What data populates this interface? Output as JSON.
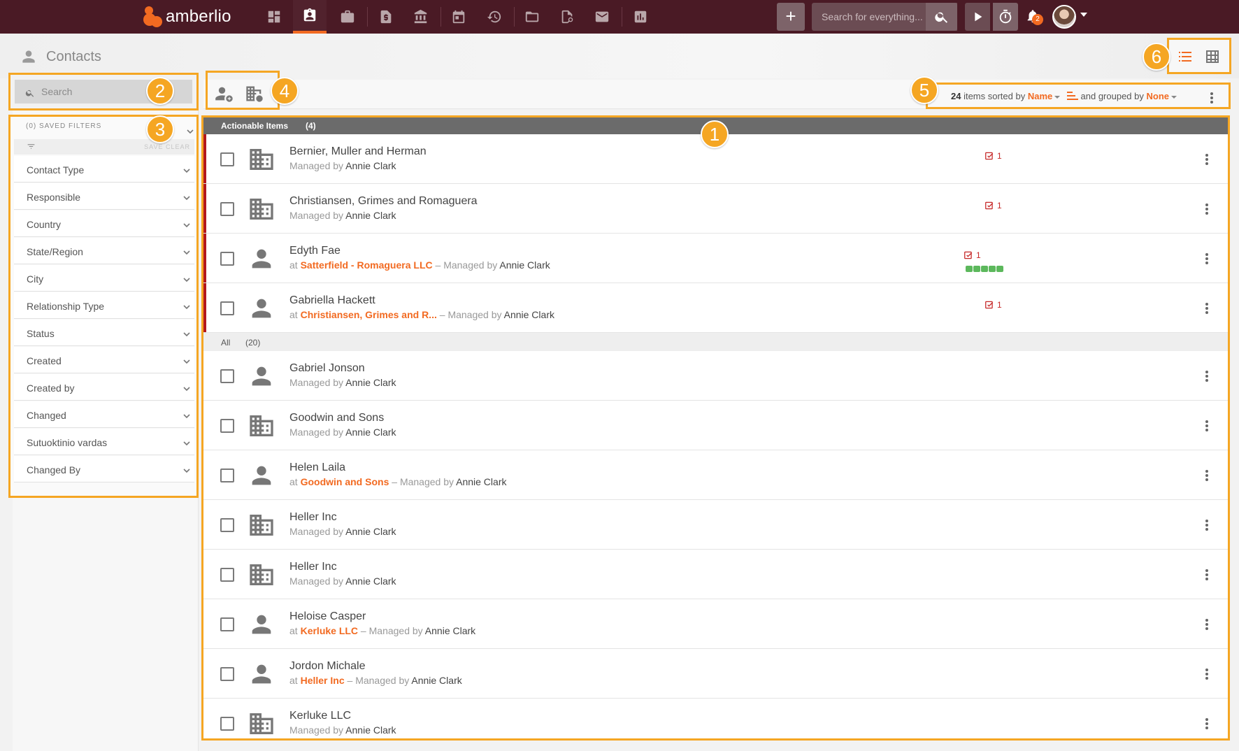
{
  "app": {
    "brand": "amberlio",
    "top_search_placeholder": "Search for everything...",
    "notification_count": "2",
    "accent": "#f26a21",
    "topbar_color": "#4a1a25",
    "nav_icons": [
      "dashboard-icon",
      "contacts-icon",
      "projects-icon",
      "invoices-icon",
      "bank-icon",
      "calendar-icon",
      "history-icon",
      "folder-icon",
      "documents-icon",
      "mail-icon",
      "reports-icon"
    ]
  },
  "page": {
    "title": "Contacts"
  },
  "sidebar": {
    "search_placeholder": "Search",
    "saved_filters": "(0) SAVED FILTERS",
    "save_clear": "SAVE  CLEAR",
    "filters": [
      {
        "label": "Contact Type"
      },
      {
        "label": "Responsible"
      },
      {
        "label": "Country"
      },
      {
        "label": "State/Region"
      },
      {
        "label": "City"
      },
      {
        "label": "Relationship Type"
      },
      {
        "label": "Status"
      },
      {
        "label": "Created"
      },
      {
        "label": "Created by"
      },
      {
        "label": "Changed"
      },
      {
        "label": "Sutuoktinio vardas"
      },
      {
        "label": "Changed By"
      }
    ]
  },
  "toolbar": {
    "count": "24",
    "sorted_by_text": " items sorted by ",
    "sort_field": "Name",
    "grouped_by_text": " and grouped by ",
    "group_field": "None"
  },
  "groups": {
    "actionable": {
      "label": "Actionable Items",
      "count": "(4)"
    },
    "all": {
      "label": "All",
      "count": "(20)"
    }
  },
  "rows": [
    {
      "name": "Bernier, Muller and Herman",
      "type": "company",
      "org": "",
      "managed_prefix": "Managed by ",
      "manager": "Annie Clark",
      "tasks": "1",
      "progress": false
    },
    {
      "name": "Christiansen, Grimes and Romaguera",
      "type": "company",
      "org": "",
      "managed_prefix": "Managed by ",
      "manager": "Annie Clark",
      "tasks": "1",
      "progress": false
    },
    {
      "name": "Edyth Fae",
      "type": "person",
      "at": "at ",
      "org": "Satterfield - Romaguera LLC",
      "sep": " –  ",
      "managed_prefix": "Managed by ",
      "manager": "Annie Clark",
      "tasks": "1",
      "progress": true
    },
    {
      "name": "Gabriella Hackett",
      "type": "person",
      "at": "at ",
      "org": "Christiansen, Grimes and R...",
      "sep": "  –  ",
      "managed_prefix": "Managed by ",
      "manager": "Annie Clark",
      "tasks": "1",
      "progress": false
    },
    {
      "name": "Gabriel Jonson",
      "type": "person",
      "org": "",
      "managed_prefix": "Managed by ",
      "manager": "Annie Clark"
    },
    {
      "name": "Goodwin and Sons",
      "type": "company",
      "org": "",
      "managed_prefix": "Managed by ",
      "manager": "Annie Clark"
    },
    {
      "name": "Helen Laila",
      "type": "person",
      "at": "at ",
      "org": "Goodwin and Sons",
      "sep": " –  ",
      "managed_prefix": "Managed by ",
      "manager": "Annie Clark"
    },
    {
      "name": "Heller Inc",
      "type": "company",
      "org": "",
      "managed_prefix": "Managed by ",
      "manager": "Annie Clark"
    },
    {
      "name": "Heller Inc",
      "type": "company",
      "org": "",
      "managed_prefix": "Managed by ",
      "manager": "Annie Clark"
    },
    {
      "name": "Heloise Casper",
      "type": "person",
      "at": "at ",
      "org": "Kerluke LLC",
      "sep": " –  ",
      "managed_prefix": "Managed by ",
      "manager": "Annie Clark"
    },
    {
      "name": "Jordon Michale",
      "type": "person",
      "at": "at ",
      "org": "Heller Inc",
      "sep": " –  ",
      "managed_prefix": "Managed by ",
      "manager": "Annie Clark"
    },
    {
      "name": "Kerluke LLC",
      "type": "company",
      "org": "",
      "managed_prefix": "Managed by ",
      "manager": "Annie Clark"
    }
  ],
  "callouts": [
    "1",
    "2",
    "3",
    "4",
    "5",
    "6"
  ]
}
